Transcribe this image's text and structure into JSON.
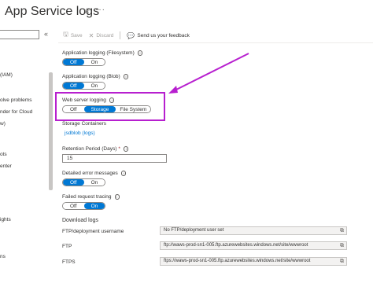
{
  "header": {
    "title": "App Service logs",
    "pin_icon": "star-icon",
    "more_icon": "ellipsis-icon"
  },
  "sidebar": {
    "items": [
      {
        "label": "(IAM)"
      },
      {
        "label": "olve problems"
      },
      {
        "label": "nder for Cloud"
      },
      {
        "label": "w)"
      },
      {
        "label": "ots"
      },
      {
        "label": "enter"
      },
      {
        "label": "ights"
      },
      {
        "label": "ns"
      }
    ]
  },
  "toolbar": {
    "save_label": "Save",
    "discard_label": "Discard",
    "feedback_label": "Send us your feedback"
  },
  "form": {
    "app_logging_fs": {
      "label": "Application logging (Filesystem)",
      "options": [
        "Off",
        "On"
      ],
      "selected": "Off"
    },
    "app_logging_blob": {
      "label": "Application logging (Blob)",
      "options": [
        "Off",
        "On"
      ],
      "selected": "Off"
    },
    "web_server_logging": {
      "label": "Web server logging",
      "options": [
        "Off",
        "Storage",
        "File System"
      ],
      "selected": "Storage"
    },
    "storage_containers": {
      "label": "Storage Containers",
      "value": "jsdblob (logs)"
    },
    "retention": {
      "label": "Retention Period (Days)",
      "required": "*",
      "value": "15"
    },
    "detailed_errors": {
      "label": "Detailed error messages",
      "options": [
        "Off",
        "On"
      ],
      "selected": "Off"
    },
    "failed_request": {
      "label": "Failed request tracing",
      "options": [
        "Off",
        "On"
      ],
      "selected": "On"
    }
  },
  "download": {
    "heading": "Download logs",
    "rows": [
      {
        "label": "FTP/deployment username",
        "value": "No FTP/deployment user set"
      },
      {
        "label": "FTP",
        "value": "ftp://waws-prod-sn1-005.ftp.azurewebsites.windows.net/site/wwwroot"
      },
      {
        "label": "FTPS",
        "value": "ftps://waws-prod-sn1-005.ftp.azurewebsites.windows.net/site/wwwroot"
      }
    ]
  },
  "colors": {
    "accent": "#0078d4",
    "highlight": "#b71fcf"
  }
}
